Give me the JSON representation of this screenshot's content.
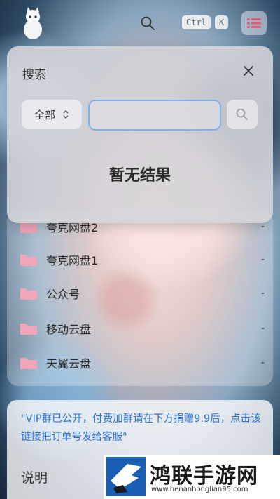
{
  "header": {
    "kbd_ctrl": "Ctrl",
    "kbd_k": "K"
  },
  "modal": {
    "title": "搜索",
    "scope_selected": "全部",
    "search_value": "",
    "empty_text": "暂无结果"
  },
  "list": {
    "items": [
      {
        "label": "夸克网盘2",
        "size": "-"
      },
      {
        "label": "夸克网盘1",
        "size": "-"
      },
      {
        "label": "公众号",
        "size": "-"
      },
      {
        "label": "移动云盘",
        "size": "-"
      },
      {
        "label": "天翼云盘",
        "size": "-"
      }
    ]
  },
  "notice": {
    "text": "\"VIP群已公开，付费加群请在下方捐赠9.9后，点击该链接把订单号发给客服\"",
    "title": "说明"
  },
  "watermark": {
    "name": "鸿联手游网",
    "url": "www.henanhonglian95.com"
  },
  "colors": {
    "folder": "#f0a6b8",
    "link": "#2a6fcf",
    "search_border": "#7fb2e6"
  }
}
